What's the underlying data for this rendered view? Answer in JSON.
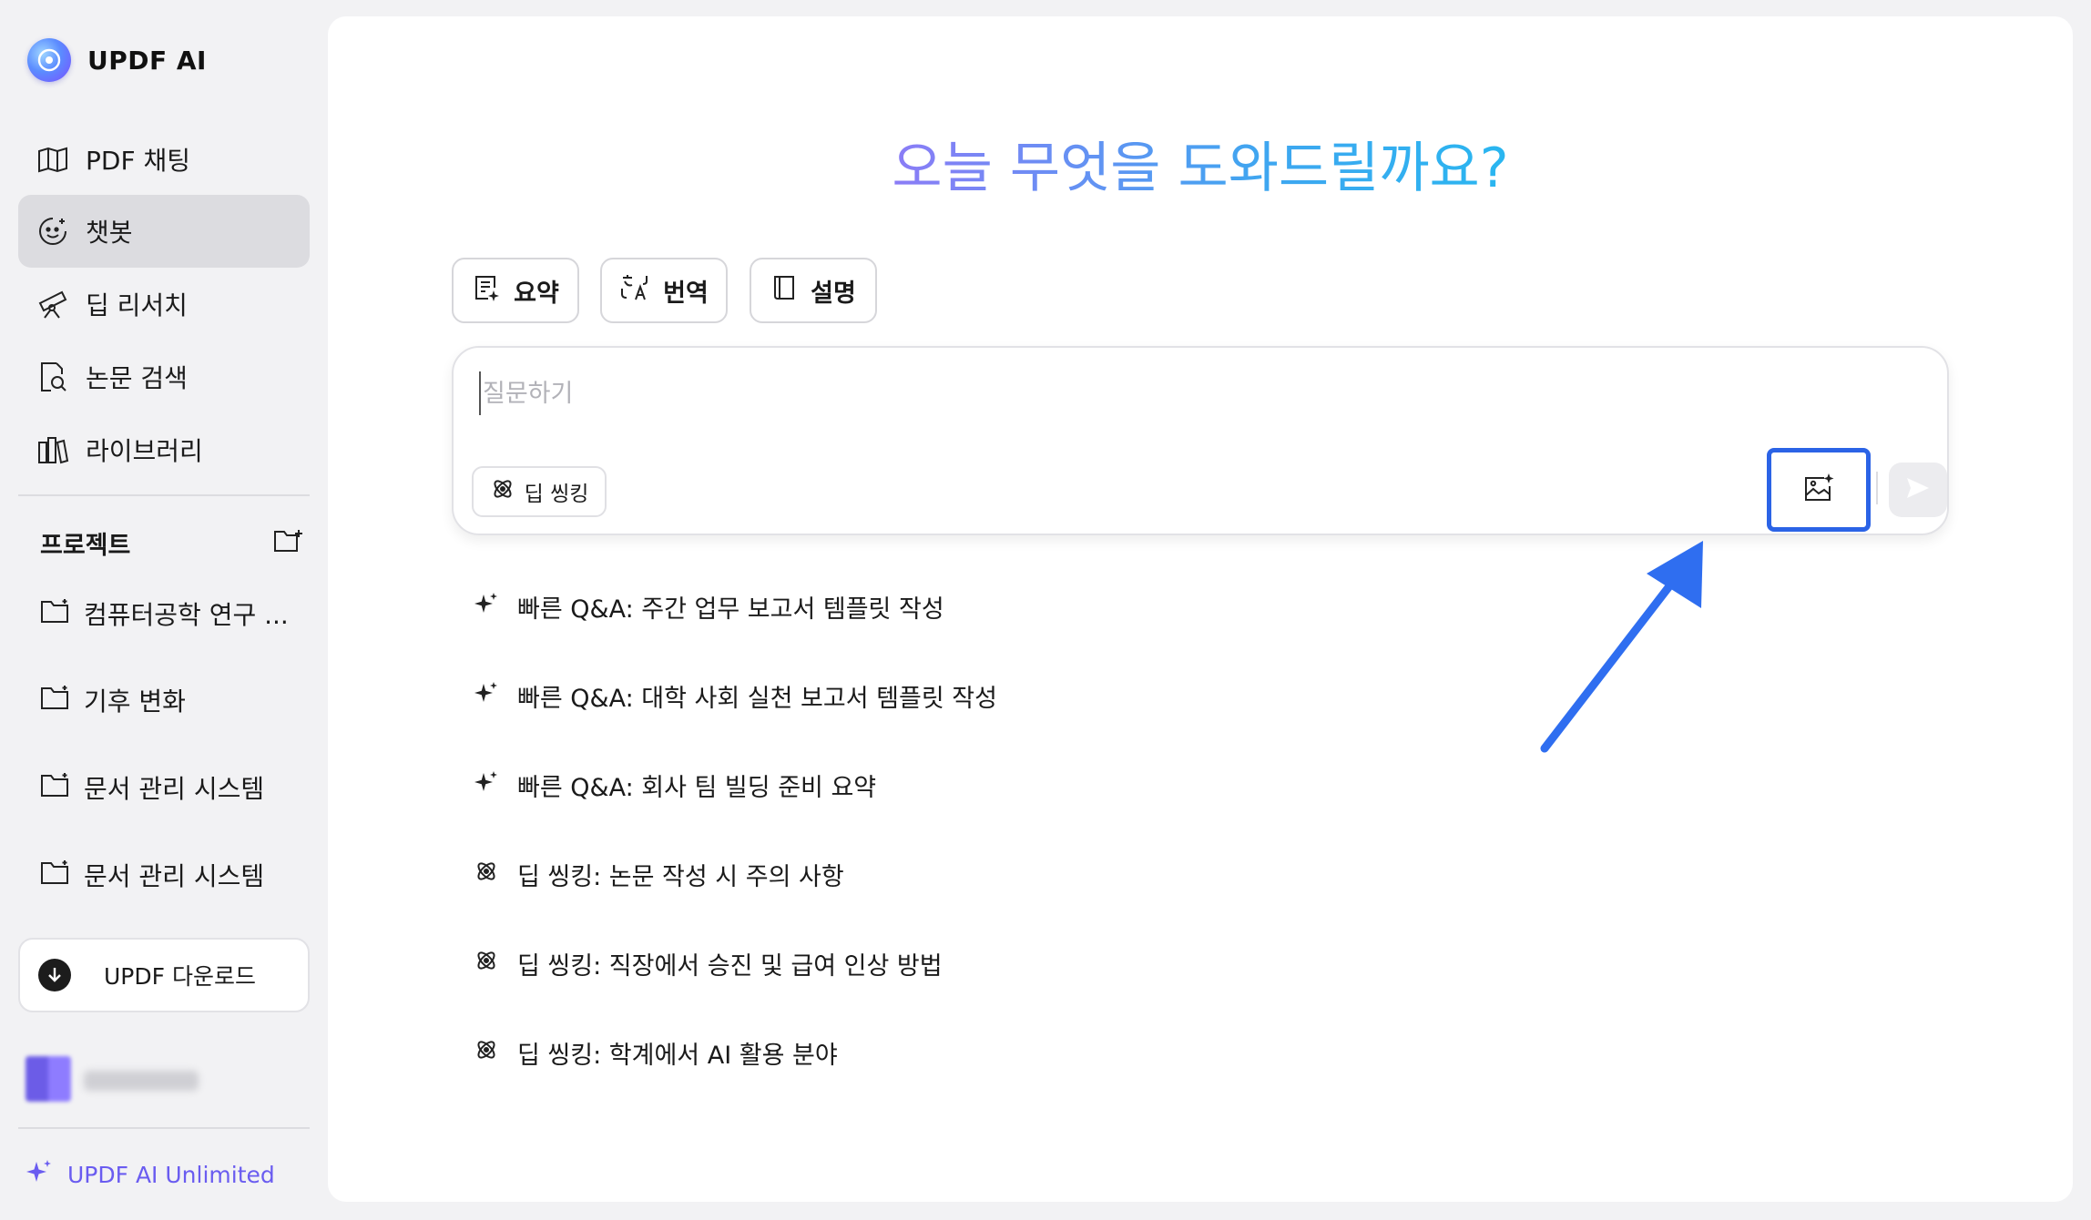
{
  "app": {
    "name": "UPDF AI"
  },
  "sidebar": {
    "items": [
      {
        "label": "PDF 채팅",
        "icon": "book-sparkle-icon"
      },
      {
        "label": "챗봇",
        "icon": "chatbot-face-icon",
        "active": true
      },
      {
        "label": "딥 리서치",
        "icon": "telescope-icon"
      },
      {
        "label": "논문 검색",
        "icon": "document-search-icon"
      },
      {
        "label": "라이브러리",
        "icon": "library-books-icon"
      }
    ],
    "projects_label": "프로젝트",
    "projects": [
      {
        "label": "컴퓨터공학 연구 ..."
      },
      {
        "label": "기후 변화"
      },
      {
        "label": "문서 관리 시스템"
      },
      {
        "label": "문서 관리 시스템"
      }
    ],
    "download_label": "UPDF 다운로드",
    "unlimited_label": "UPDF AI Unlimited"
  },
  "main": {
    "headline": "오늘 무엇을 도와드릴까요?",
    "chips": [
      {
        "label": "요약",
        "icon": "summary-doc-icon"
      },
      {
        "label": "번역",
        "icon": "translate-icon"
      },
      {
        "label": "설명",
        "icon": "book-icon"
      }
    ],
    "input": {
      "placeholder": "질문하기",
      "value": ""
    },
    "deep_thinking_label": "딥 씽킹",
    "suggestions": [
      {
        "icon": "sparkle-icon",
        "text": "빠른 Q&A: 주간 업무 보고서 템플릿 작성"
      },
      {
        "icon": "sparkle-icon",
        "text": "빠른 Q&A: 대학 사회 실천 보고서 템플릿 작성"
      },
      {
        "icon": "sparkle-icon",
        "text": "빠른 Q&A: 회사 팀 빌딩 준비 요약"
      },
      {
        "icon": "atom-icon",
        "text": "딥 씽킹: 논문 작성 시 주의 사항"
      },
      {
        "icon": "atom-icon",
        "text": "딥 씽킹: 직장에서 승진 및 급여 인상 방법"
      },
      {
        "icon": "atom-icon",
        "text": "딥 씽킹: 학계에서 AI 활용 분야"
      }
    ]
  },
  "colors": {
    "accent": "#2b63e6",
    "unlimited": "#6a5cf0",
    "headline_start": "#8b7cf6",
    "headline_end": "#29b6f0"
  }
}
